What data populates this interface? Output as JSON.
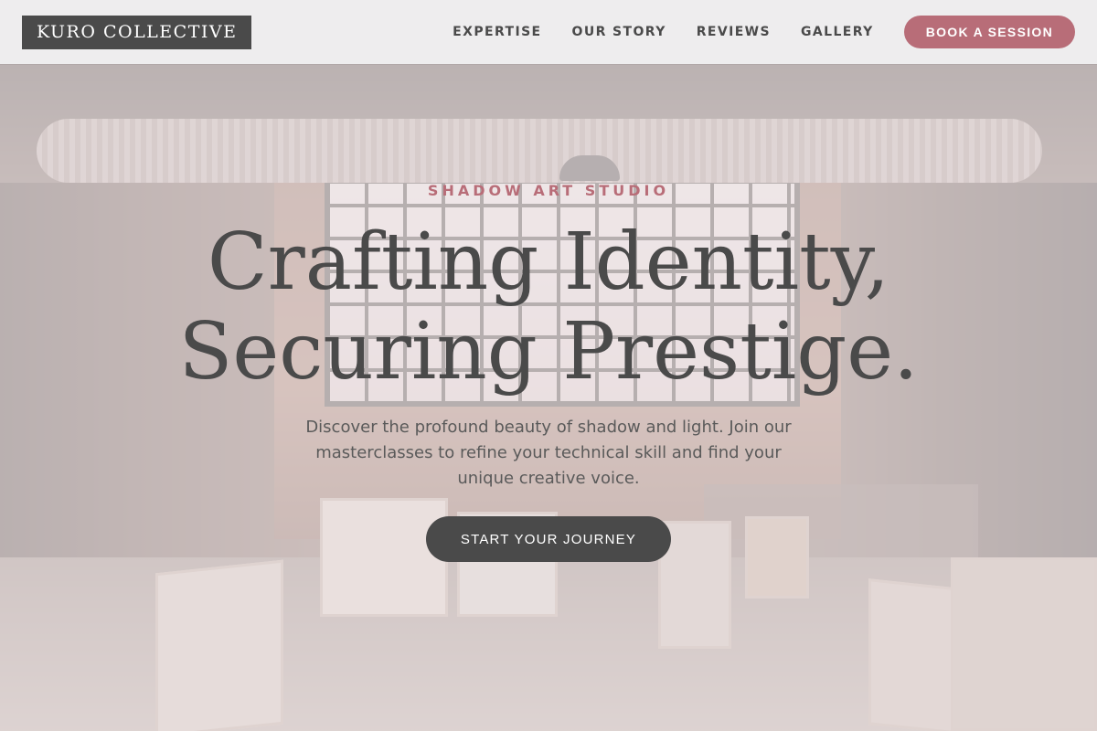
{
  "header": {
    "logo": "KURO COLLECTIVE",
    "nav": [
      {
        "label": "EXPERTISE"
      },
      {
        "label": "OUR STORY"
      },
      {
        "label": "REVIEWS"
      },
      {
        "label": "GALLERY"
      }
    ],
    "cta_label": "BOOK A SESSION"
  },
  "hero": {
    "eyebrow": "SHADOW ART STUDIO",
    "headline_line1": "Crafting Identity,",
    "headline_line2": "Securing Prestige.",
    "intro": "Discover the profound beauty of shadow and light. Join our masterclasses to refine your technical skill and find your unique creative voice.",
    "cta_label": "START YOUR JOURNEY"
  },
  "colors": {
    "accent": "#b86d78",
    "dark": "#4a4a4a",
    "header_bg": "#eeedee"
  }
}
